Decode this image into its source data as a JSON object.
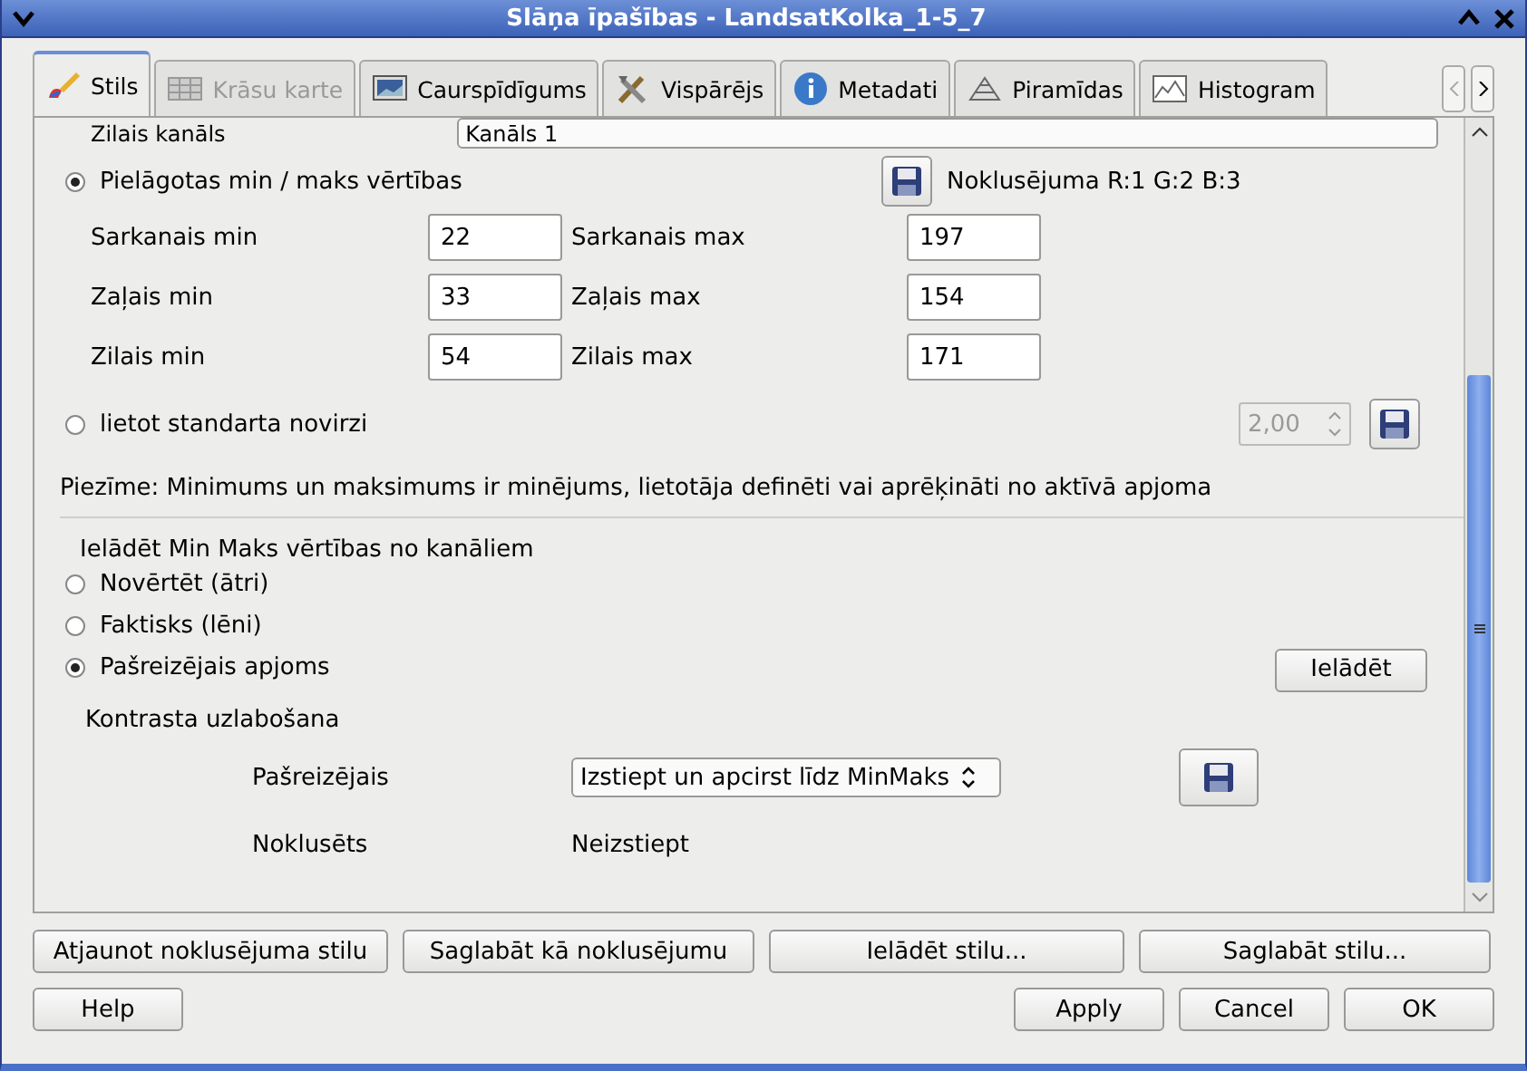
{
  "window": {
    "title": "Slāņa īpašības - LandsatKolka_1-5_7"
  },
  "tabs": [
    {
      "label": "Stils",
      "selected": true,
      "disabled": false
    },
    {
      "label": "Krāsu karte",
      "selected": false,
      "disabled": true
    },
    {
      "label": "Caurspīdīgums",
      "selected": false,
      "disabled": false
    },
    {
      "label": "Vispārējs",
      "selected": false,
      "disabled": false
    },
    {
      "label": "Metadati",
      "selected": false,
      "disabled": false
    },
    {
      "label": "Piramīdas",
      "selected": false,
      "disabled": false
    },
    {
      "label": "Histogram",
      "selected": false,
      "disabled": false
    }
  ],
  "band_row": {
    "label": "Zilais kanāls",
    "value": "Kanāls 1"
  },
  "minmax_mode": [
    {
      "label": "Pielāgotas min / maks vērtības",
      "selected": true
    },
    {
      "label": "lietot standarta novirzi",
      "selected": false
    }
  ],
  "default_bands": "Noklusējuma R:1 G:2 B:3",
  "minmax_fields": [
    {
      "label": "Sarkanais min",
      "value": "22"
    },
    {
      "label": "Sarkanais max",
      "value": "197"
    },
    {
      "label": "Zaļais min",
      "value": "33"
    },
    {
      "label": "Zaļais max",
      "value": "154"
    },
    {
      "label": "Zilais min",
      "value": "54"
    },
    {
      "label": "Zilais max",
      "value": "171"
    }
  ],
  "std_dev": {
    "value": "2,00",
    "disabled": true
  },
  "note": "Piezīme: Minimums un maksimums ir minējums, lietotāja definēti vai aprēķināti no aktīvā apjoma",
  "load": {
    "title": "Ielādēt Min Maks vērtības no kanāliem",
    "options": [
      {
        "label": "Novērtēt (ātri)",
        "selected": false
      },
      {
        "label": "Faktisks (lēni)",
        "selected": false
      },
      {
        "label": "Pašreizējais apjoms",
        "selected": true
      }
    ],
    "button": "Ielādēt"
  },
  "contrast": {
    "title": "Kontrasta uzlabošana",
    "current_label": "Pašreizējais",
    "current_value": "Izstiept un apcirst līdz MinMaks",
    "default_label": "Noklusēts",
    "default_value": "Neizstiept"
  },
  "style_buttons": [
    "Atjaunot noklusējuma stilu",
    "Saglabāt kā noklusējumu",
    "Ielādēt stilu...",
    "Saglabāt stilu..."
  ],
  "help_button": "Help",
  "dialog_buttons": [
    "Apply",
    "Cancel",
    "OK"
  ]
}
